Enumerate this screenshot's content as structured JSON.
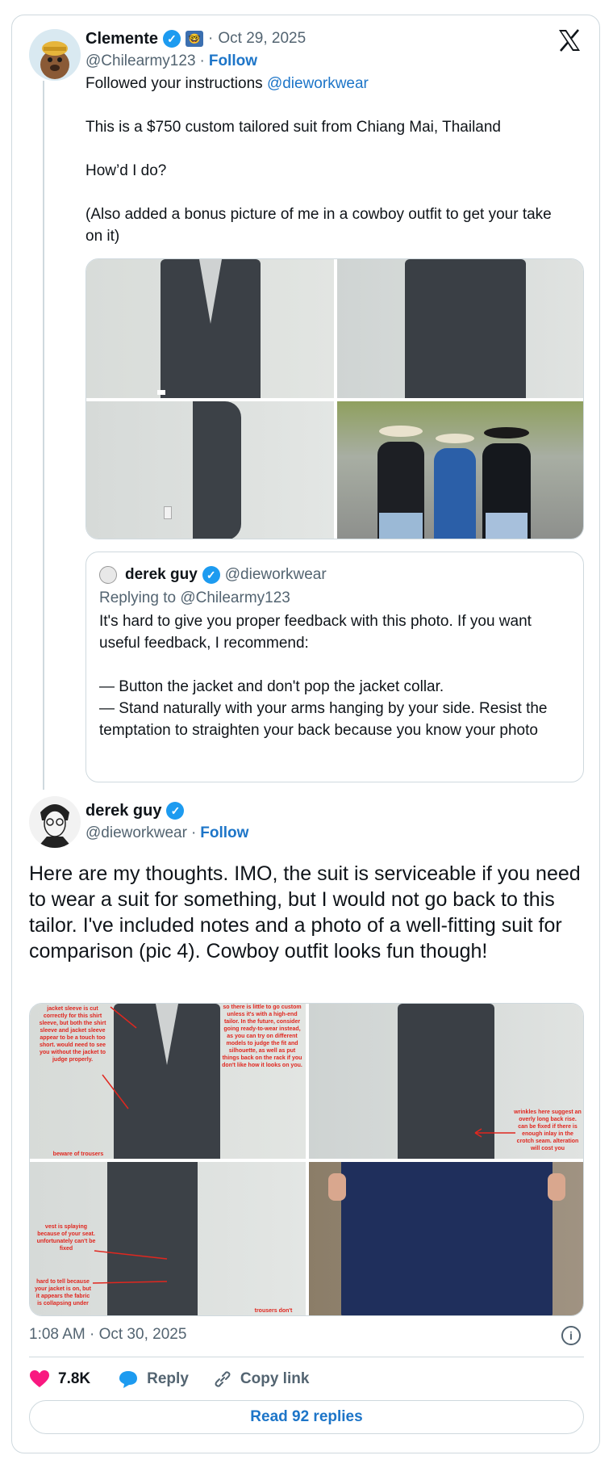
{
  "tweet": {
    "author": {
      "name": "Clemente",
      "handle": "@Chilearmy123",
      "date": "Oct 29, 2025",
      "follow_label": "Follow",
      "emoji_label": "🤓"
    },
    "text_intro": "Followed your instructions ",
    "mention": "@dieworkwear",
    "text_body": "This is a $750 custom tailored suit from Chiang Mai, Thailand\n\nHow’d I do?\n\n(Also added a bonus picture of me in a cowboy outfit to get your take on it)"
  },
  "quoted": {
    "name": "derek guy",
    "handle": "@dieworkwear",
    "replying_to": "Replying to @Chilearmy123",
    "text": "It's hard to give you proper feedback with this photo. If you want useful feedback, I recommend:\n\n— Button the jacket and don't pop the jacket collar.\n— Stand naturally with your arms hanging by your side. Resist the temptation to straighten your back because you know your photo"
  },
  "reply": {
    "name": "derek guy",
    "handle": "@dieworkwear",
    "follow_label": "Follow",
    "text": "Here are my thoughts. IMO, the suit is serviceable if you need to wear a suit for something, but I would not go back to this tailor. I've included notes and a photo of a well-fitting suit for comparison (pic 4). Cowboy outfit looks fun though!",
    "notes": {
      "n1": "jacket sleeve is cut correctly for this shirt sleeve, but both the shirt sleeve and jacket sleeve appear to be a touch too short. would need to see you without the jacket to judge properly.",
      "n2": "so there is little to go custom unless it's with a high-end tailor. In the future, consider going ready-to-wear instead, as you can try on different models to judge the fit and silhouette, as well as put things back on the rack if you don't like how it looks on you.",
      "n3": "beware of trousers",
      "n4": "wrinkles here suggest an overly long back rise. can be fixed if there is enough inlay in the crotch seam. alteration will cost you",
      "n5": "vest is splaying because of your seat. unfortunately can't be fixed",
      "n6": "hard to tell because your jacket is on, but it appears the fabric is collapsing under",
      "n7": "trousers don't"
    },
    "timestamp": "1:08 AM · Oct 30, 2025"
  },
  "actions": {
    "likes": "7.8K",
    "reply_label": "Reply",
    "copy_label": "Copy link",
    "read_replies": "Read 92 replies"
  },
  "colors": {
    "accent": "#1d9bf0",
    "link": "#1d75c8",
    "like": "#f91880",
    "border": "#cfd9de",
    "muted": "#536471"
  }
}
